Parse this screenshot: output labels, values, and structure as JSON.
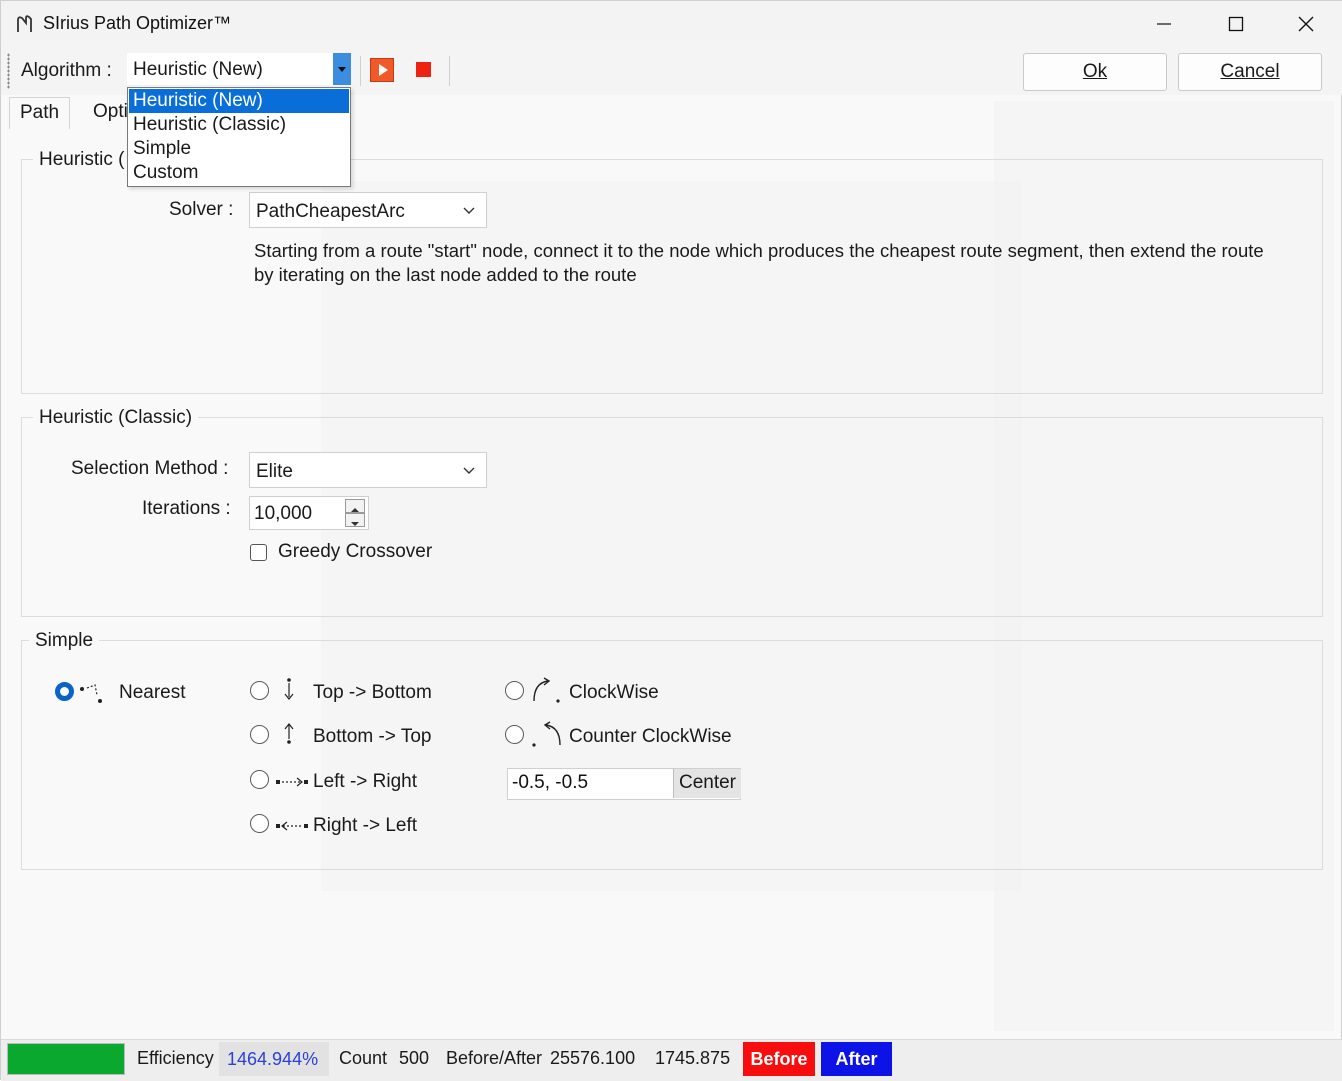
{
  "window": {
    "title": "SIrius Path Optimizer™"
  },
  "toolbar": {
    "algorithm_label": "Algorithm :",
    "algorithm_value": "Heuristic (New)",
    "ok_label": "Ok",
    "cancel_label": "Cancel"
  },
  "dropdown": {
    "options": [
      "Heuristic (New)",
      "Heuristic (Classic)",
      "Simple",
      "Custom"
    ],
    "selected_index": 0
  },
  "tabs": [
    {
      "label": "Path"
    },
    {
      "label": "Opti"
    }
  ],
  "heuristic_new": {
    "title": "Heuristic (",
    "solver_label": "Solver :",
    "solver_value": "PathCheapestArc",
    "description": "Starting from a route \"start\" node, connect it to the node which produces the cheapest route segment, then extend the route by iterating on the last node added to the route"
  },
  "heuristic_classic": {
    "title": "Heuristic (Classic)",
    "selection_label": "Selection Method :",
    "selection_value": "Elite",
    "iterations_label": "Iterations :",
    "iterations_value": "10,000",
    "greedy_label": "Greedy Crossover",
    "greedy_checked": false
  },
  "simple": {
    "title": "Simple",
    "options": [
      {
        "label": "Nearest",
        "icon": "nearest-icon",
        "checked": true
      },
      {
        "label": "Top -> Bottom",
        "icon": "arrow-down-icon",
        "checked": false
      },
      {
        "label": "Bottom -> Top",
        "icon": "arrow-up-icon",
        "checked": false
      },
      {
        "label": "Left -> Right",
        "icon": "arrow-right-icon",
        "checked": false
      },
      {
        "label": "Right -> Left",
        "icon": "arrow-left-icon",
        "checked": false
      },
      {
        "label": "ClockWise",
        "icon": "clockwise-icon",
        "checked": false
      },
      {
        "label": "Counter ClockWise",
        "icon": "counter-clockwise-icon",
        "checked": false
      }
    ],
    "center_value": "-0.5, -0.5",
    "center_button": "Center"
  },
  "status": {
    "progress_fraction": 1.0,
    "efficiency_label": "Efficiency",
    "efficiency_value": "1464.944%",
    "count_label": "Count",
    "count_value": "500",
    "before_after_label": "Before/After",
    "before_value": "25576.100",
    "after_value": "1745.875",
    "before_badge": "Before",
    "after_badge": "After"
  },
  "colors": {
    "accent": "#0a6ed8",
    "progress": "#0ba82f",
    "before_badge": "#f70d0d",
    "after_badge": "#0d12e6",
    "play": "#f05a28",
    "stop": "#ee2211"
  }
}
